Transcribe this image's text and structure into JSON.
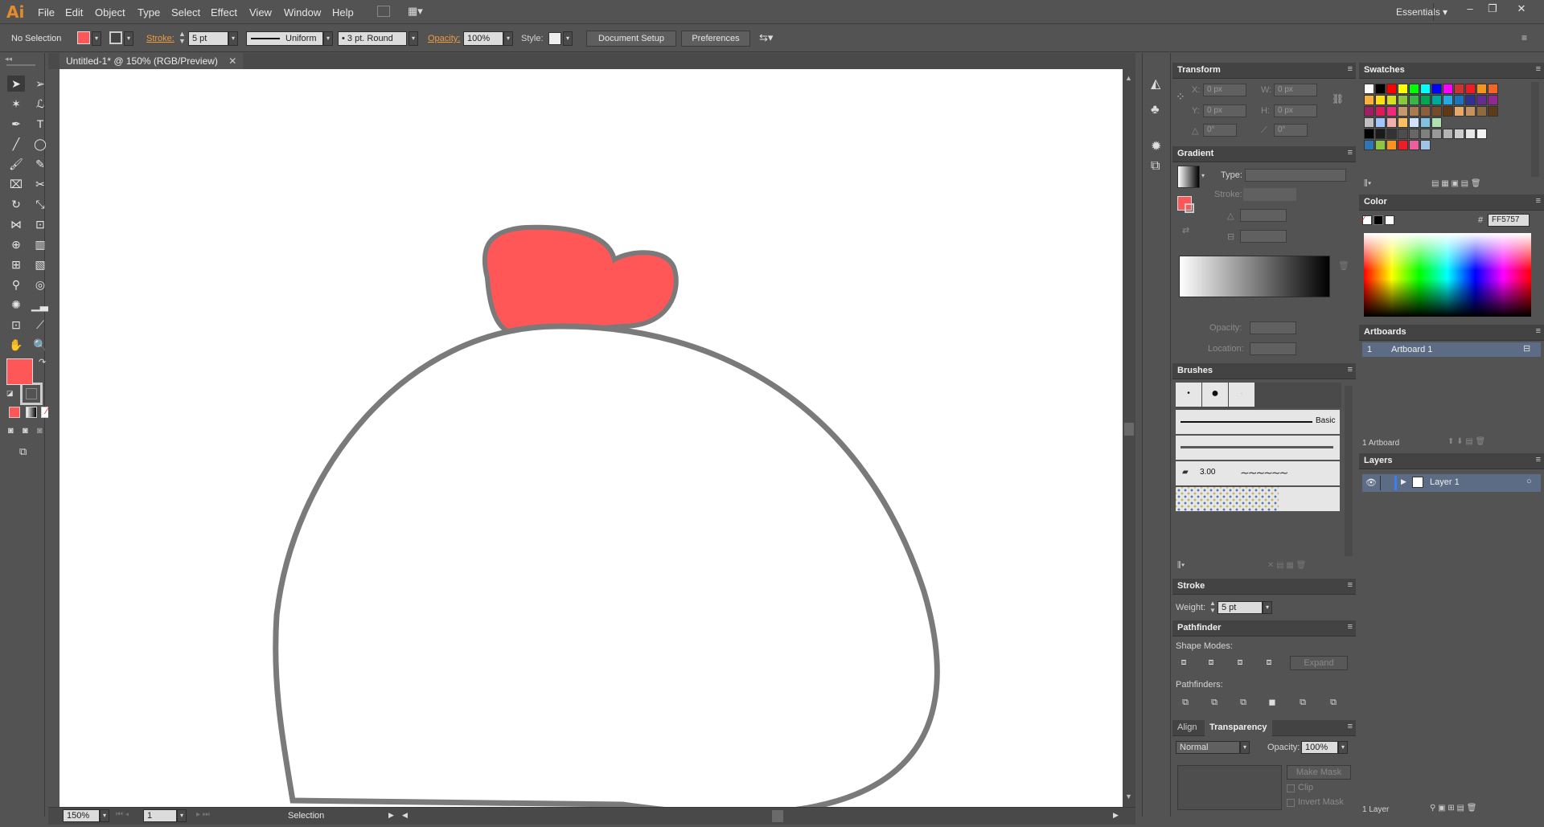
{
  "app": {
    "logo": "Ai",
    "workspace": "Essentials"
  },
  "menu": [
    "File",
    "Edit",
    "Object",
    "Type",
    "Select",
    "Effect",
    "View",
    "Window",
    "Help"
  ],
  "control_bar": {
    "selection_label": "No Selection",
    "stroke_label": "Stroke:",
    "stroke_value": "5 pt",
    "profile": "Uniform",
    "brush": "3 pt. Round",
    "opacity_label": "Opacity:",
    "opacity_value": "100%",
    "style_label": "Style:",
    "document_setup": "Document Setup",
    "preferences": "Preferences"
  },
  "document": {
    "tab_title": "Untitled-1* @ 150% (RGB/Preview)",
    "zoom": "150%",
    "artboard_num": "1",
    "status_tool": "Selection"
  },
  "colors": {
    "fill": "#FF5757",
    "stroke": "#7A7A7A",
    "ui_bg": "#535353"
  },
  "transform": {
    "title": "Transform",
    "x_label": "X:",
    "x_value": "0 px",
    "y_label": "Y:",
    "y_value": "0 px",
    "w_label": "W:",
    "w_value": "0 px",
    "h_label": "H:",
    "h_value": "0 px",
    "angle_value": "0°",
    "shear_value": "0°"
  },
  "gradient": {
    "title": "Gradient",
    "type_label": "Type:",
    "stroke_label": "Stroke:",
    "opacity_label": "Opacity:",
    "location_label": "Location:"
  },
  "brushes": {
    "title": "Brushes",
    "basic_label": "Basic",
    "size_label": "3.00"
  },
  "stroke_panel": {
    "title": "Stroke",
    "weight_label": "Weight:",
    "weight_value": "5 pt"
  },
  "pathfinder": {
    "title": "Pathfinder",
    "shape_modes": "Shape Modes:",
    "pathfinders": "Pathfinders:",
    "expand": "Expand"
  },
  "transparency": {
    "tab_align": "Align",
    "tab_transparency": "Transparency",
    "blend_mode": "Normal",
    "opacity_label": "Opacity:",
    "opacity_value": "100%",
    "make_mask": "Make Mask",
    "clip": "Clip",
    "invert_mask": "Invert Mask"
  },
  "swatches": {
    "title": "Swatches"
  },
  "color_panel": {
    "title": "Color",
    "hex_label": "#",
    "hex_value": "FF5757"
  },
  "artboards": {
    "title": "Artboards",
    "items": [
      {
        "num": "1",
        "name": "Artboard 1"
      }
    ],
    "count": "1 Artboard"
  },
  "layers": {
    "title": "Layers",
    "items": [
      {
        "name": "Layer 1"
      }
    ],
    "count": "1 Layer"
  },
  "swatch_colors": [
    [
      "#ffffff",
      "#000000",
      "#ff0000",
      "#ffff00",
      "#00ff00",
      "#00ffff",
      "#0000ff",
      "#ff00ff",
      "#cc3333",
      "#ee1c24",
      "#f7941d",
      "#f26522"
    ],
    [
      "#fbaf3f",
      "#ffde17",
      "#d7df23",
      "#8dc63f",
      "#39b54a",
      "#00a651",
      "#00a99d",
      "#27aae1",
      "#1c75bc",
      "#2e3192",
      "#662d91",
      "#92278f"
    ],
    [
      "#9e1f63",
      "#da1c5c",
      "#ee2a7b",
      "#c49a6c",
      "#a97c50",
      "#8b5e3c",
      "#754c29",
      "#603913",
      "#e6a96a",
      "#c8925f",
      "#8f6a3f",
      "#5a3b1a"
    ],
    [
      "#c0c0c0",
      "#a0c8ff",
      "#f0b0b0",
      "#fabf5f",
      "#d0e0ff",
      "#80c0e0",
      "#b0e0b0"
    ],
    [
      "#000000",
      "#1a1a1a",
      "#333333",
      "#4d4d4d",
      "#666666",
      "#808080",
      "#999999",
      "#b3b3b3",
      "#cccccc",
      "#e6e6e6",
      "#f2f2f2"
    ],
    [
      "#2e75b6",
      "#8dc63f",
      "#f7941d",
      "#ee1c24",
      "#ec5f9f",
      "#9fc4e7"
    ]
  ]
}
